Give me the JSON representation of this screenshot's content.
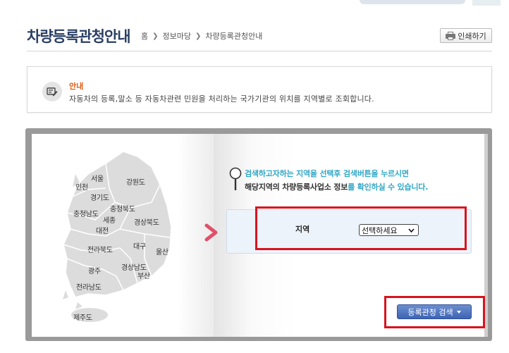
{
  "header": {
    "title": "차량등록관청안내",
    "breadcrumb": [
      "홈",
      "정보마당",
      "차량등록관청안내"
    ],
    "print_label": "인쇄하기"
  },
  "notice": {
    "title": "안내",
    "text": "자동차의 등록,말소 등 자동차관련 민원을 처리하는 국가기관의 위치를 지역별로 조회합니다."
  },
  "map": {
    "regions": {
      "seoul": "서울",
      "incheon": "인천",
      "gangwon": "강원도",
      "gyeonggi": "경기도",
      "chungbuk": "충청북도",
      "chungnam": "충청남도",
      "sejong": "세종",
      "daejeon": "대전",
      "gyeongbuk": "경상북도",
      "jeonbuk": "전라북도",
      "daegu": "대구",
      "ulsan": "울산",
      "gwangju": "광주",
      "gyeongnam": "경상남도",
      "busan": "부산",
      "jeonnam": "전라남도",
      "jeju": "제주도"
    }
  },
  "info": {
    "line1": "검색하고자하는 지역을 선택후 검색버튼을 누르시면",
    "line2_prefix": "해당지역의 차량등록사업소 정보",
    "line2_highlight": "를 확인하실 수 있습니다."
  },
  "search": {
    "region_label": "지역",
    "region_selected": "선택하세요",
    "button_label": "등록관청 검색"
  },
  "colors": {
    "title": "#2a3f64",
    "accent_orange": "#e05a12",
    "accent_teal": "#31a7c6",
    "highlight_red": "#d8141e",
    "button_blue": "#3d64b4"
  }
}
